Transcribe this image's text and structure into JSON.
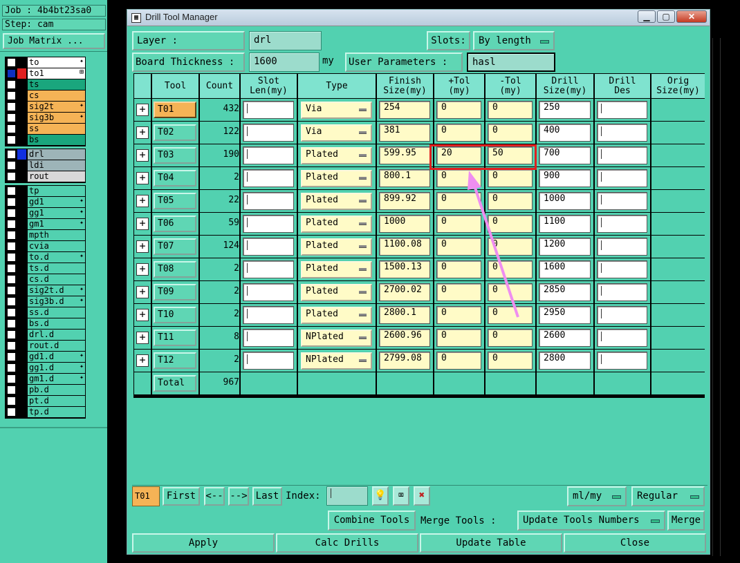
{
  "left_panel": {
    "job": "Job : 4b4bt23sa0",
    "step": "Step: cam",
    "job_matrix": "Job Matrix ...",
    "group1": [
      {
        "name": "to",
        "color": "#000000",
        "bg": "#ffffff",
        "mark": "✦"
      },
      {
        "name": "to1",
        "color": "#e02020",
        "bg": "#ffffff",
        "mark": "⊞",
        "selected": true
      },
      {
        "name": "ts",
        "color": "#000000",
        "bg": "#1aa67d",
        "mark": ""
      },
      {
        "name": "cs",
        "color": "#000000",
        "bg": "#f5b356",
        "mark": ""
      },
      {
        "name": "sig2t",
        "color": "#000000",
        "bg": "#f5b356",
        "mark": "✦"
      },
      {
        "name": "sig3b",
        "color": "#000000",
        "bg": "#f5b356",
        "mark": "✦"
      },
      {
        "name": "ss",
        "color": "#000000",
        "bg": "#f5b356",
        "mark": ""
      },
      {
        "name": "bs",
        "color": "#000000",
        "bg": "#1aa67d",
        "mark": ""
      }
    ],
    "group2": [
      {
        "name": "drl",
        "color": "#1030e0",
        "bg": "#9db4b8",
        "mark": ""
      },
      {
        "name": "ldi",
        "color": "#000000",
        "bg": "#9db4b8",
        "mark": ""
      },
      {
        "name": "rout",
        "color": "#000000",
        "bg": "#d8d8d8",
        "mark": ""
      }
    ],
    "group3": [
      {
        "name": "tp",
        "mark": ""
      },
      {
        "name": "gd1",
        "mark": "✦"
      },
      {
        "name": "gg1",
        "mark": "✦"
      },
      {
        "name": "gm1",
        "mark": "✦"
      },
      {
        "name": "mpth",
        "mark": ""
      },
      {
        "name": "cvia",
        "mark": ""
      },
      {
        "name": "to.d",
        "mark": "✦"
      },
      {
        "name": "ts.d",
        "mark": ""
      },
      {
        "name": "cs.d",
        "mark": ""
      },
      {
        "name": "sig2t.d",
        "mark": "✦"
      },
      {
        "name": "sig3b.d",
        "mark": "✦"
      },
      {
        "name": "ss.d",
        "mark": ""
      },
      {
        "name": "bs.d",
        "mark": ""
      },
      {
        "name": "drl.d",
        "mark": ""
      },
      {
        "name": "rout.d",
        "mark": ""
      },
      {
        "name": "gd1.d",
        "mark": "✦"
      },
      {
        "name": "gg1.d",
        "mark": "✦"
      },
      {
        "name": "gm1.d",
        "mark": "✦"
      },
      {
        "name": "pb.d",
        "mark": ""
      },
      {
        "name": "pt.d",
        "mark": ""
      },
      {
        "name": "tp.d",
        "mark": ""
      }
    ]
  },
  "window": {
    "title": "Drill Tool Manager",
    "layer_label": "Layer :",
    "layer_value": "drl",
    "slots_label": "Slots:",
    "slots_value": "By length",
    "thickness_label": "Board Thickness :",
    "thickness_value": "1600",
    "thickness_unit": "my",
    "user_params_label": "User Parameters :",
    "user_params_value": "hasl"
  },
  "table": {
    "headers": [
      "Tool",
      "Count",
      "Slot\nLen(my)",
      "Type",
      "Finish\nSize(my)",
      "+Tol\n(my)",
      "-Tol\n(my)",
      "Drill\nSize(my)",
      "Drill\nDes",
      "Orig\nSize(my)"
    ],
    "rows": [
      {
        "tool": "T01",
        "count": "432",
        "type": "Via",
        "finish": "254",
        "ptol": "0",
        "mtol": "0",
        "drill": "250"
      },
      {
        "tool": "T02",
        "count": "122",
        "type": "Via",
        "finish": "381",
        "ptol": "0",
        "mtol": "0",
        "drill": "400"
      },
      {
        "tool": "T03",
        "count": "190",
        "type": "Plated",
        "finish": "599.95",
        "ptol": "20",
        "mtol": "50",
        "drill": "700"
      },
      {
        "tool": "T04",
        "count": "2",
        "type": "Plated",
        "finish": "800.1",
        "ptol": "0",
        "mtol": "0",
        "drill": "900"
      },
      {
        "tool": "T05",
        "count": "22",
        "type": "Plated",
        "finish": "899.92",
        "ptol": "0",
        "mtol": "0",
        "drill": "1000"
      },
      {
        "tool": "T06",
        "count": "59",
        "type": "Plated",
        "finish": "1000",
        "ptol": "0",
        "mtol": "0",
        "drill": "1100"
      },
      {
        "tool": "T07",
        "count": "124",
        "type": "Plated",
        "finish": "1100.08",
        "ptol": "0",
        "mtol": "0",
        "drill": "1200"
      },
      {
        "tool": "T08",
        "count": "2",
        "type": "Plated",
        "finish": "1500.13",
        "ptol": "0",
        "mtol": "0",
        "drill": "1600"
      },
      {
        "tool": "T09",
        "count": "2",
        "type": "Plated",
        "finish": "2700.02",
        "ptol": "0",
        "mtol": "0",
        "drill": "2850"
      },
      {
        "tool": "T10",
        "count": "2",
        "type": "Plated",
        "finish": "2800.1",
        "ptol": "0",
        "mtol": "0",
        "drill": "2950"
      },
      {
        "tool": "T11",
        "count": "8",
        "type": "NPlated",
        "finish": "2600.96",
        "ptol": "0",
        "mtol": "0",
        "drill": "2600"
      },
      {
        "tool": "T12",
        "count": "2",
        "type": "NPlated",
        "finish": "2799.08",
        "ptol": "0",
        "mtol": "0",
        "drill": "2800"
      }
    ],
    "total_label": "Total",
    "total_count": "967"
  },
  "nav": {
    "current_tool": "T01",
    "first": "First",
    "prev": "<--",
    "next": "-->",
    "last": "Last",
    "index_label": "Index:",
    "units": "ml/my",
    "mode": "Regular"
  },
  "actions": {
    "combine": "Combine Tools",
    "merge_label": "Merge Tools :",
    "merge_select": "Update Tools Numbers",
    "merge_btn": "Merge",
    "apply": "Apply",
    "calc": "Calc Drills",
    "update": "Update Table",
    "close": "Close"
  },
  "colors": {
    "panel": "#52d1b0",
    "highlight_box": "#e02020",
    "arrow": "#ef8ef0"
  }
}
